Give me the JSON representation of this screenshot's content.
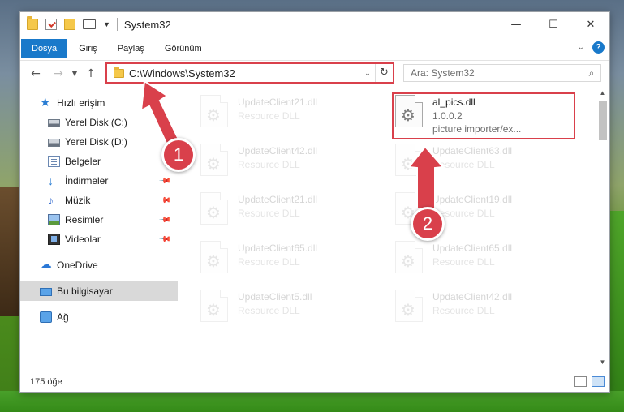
{
  "window": {
    "title": "System32"
  },
  "ribbon": {
    "tabs": [
      "Dosya",
      "Giriş",
      "Paylaş",
      "Görünüm"
    ]
  },
  "address": {
    "path": "C:\\Windows\\System32"
  },
  "search": {
    "placeholder": "Ara: System32"
  },
  "sidebar": {
    "items": [
      {
        "label": "Hızlı erişim",
        "icon": "star-icon"
      },
      {
        "label": "Yerel Disk (C:)",
        "icon": "drive-icon"
      },
      {
        "label": "Yerel Disk (D:)",
        "icon": "drive-icon"
      },
      {
        "label": "Belgeler",
        "icon": "documents-icon"
      },
      {
        "label": "İndirmeler",
        "icon": "download-icon"
      },
      {
        "label": "Müzik",
        "icon": "music-icon"
      },
      {
        "label": "Resimler",
        "icon": "pictures-icon"
      },
      {
        "label": "Videolar",
        "icon": "video-icon"
      },
      {
        "label": "OneDrive",
        "icon": "cloud-icon"
      },
      {
        "label": "Bu bilgisayar",
        "icon": "computer-icon"
      },
      {
        "label": "Ağ",
        "icon": "network-icon"
      }
    ]
  },
  "files": {
    "main": {
      "name": "al_pics.dll",
      "version": "1.0.0.2",
      "description": "picture importer/ex..."
    },
    "faded": [
      {
        "name": "UpdateClient21.dll",
        "type": "Resource DLL"
      },
      {
        "name": "UpdateClient42.dll",
        "type": "Resource DLL"
      },
      {
        "name": "UpdateClient63.dll",
        "type": "Resource DLL"
      },
      {
        "name": "UpdateClient21.dll",
        "type": "Resource DLL"
      },
      {
        "name": "UpdateClient19.dll",
        "type": "Resource DLL"
      },
      {
        "name": "UpdateClient65.dll",
        "type": "Resource DLL"
      },
      {
        "name": "UpdateClient65.dll",
        "type": "Resource DLL"
      },
      {
        "name": "UpdateClient5.dll",
        "type": "Resource DLL"
      },
      {
        "name": "UpdateClient42.dll",
        "type": "Resource DLL"
      }
    ]
  },
  "status": {
    "count": "175 öğe"
  },
  "callouts": [
    "1",
    "2"
  ],
  "colors": {
    "accent": "#1979ca",
    "callout": "#d9404b"
  }
}
